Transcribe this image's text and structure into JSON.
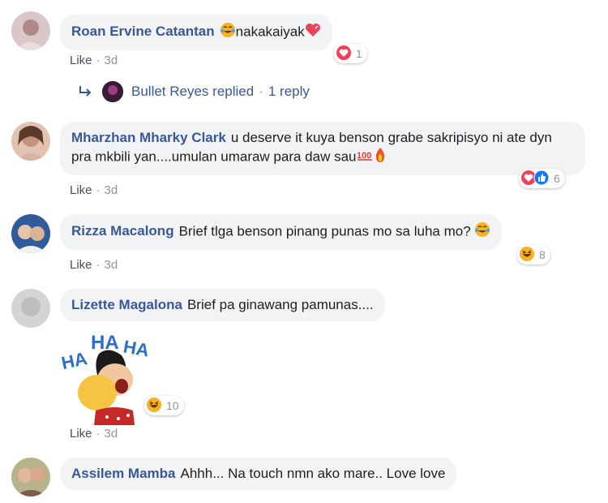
{
  "comments": [
    {
      "author": "Roan Ervine Catantan",
      "text": "nakakaiyak",
      "like": "Like",
      "time": "3d",
      "reaction_count": "1"
    },
    {
      "author": "Mharzhan Mharky Clark",
      "text": "u deserve it kuya benson grabe sakripisyo ni ate dyn pra mkbili yan....umulan umaraw para daw sau",
      "like": "Like",
      "time": "3d",
      "reaction_count": "6"
    },
    {
      "author": "Rizza Macalong",
      "text": "Brief tlga benson pinang punas mo sa luha mo?",
      "like": "Like",
      "time": "3d",
      "reaction_count": "8"
    },
    {
      "author": "Lizette Magalona",
      "text": "Brief pa ginawang pamunas....",
      "like": "Like",
      "time": "3d",
      "reaction_count": "10",
      "sticker_text": "HA HA HA"
    },
    {
      "author": "Assilem Mamba",
      "text": "Ahhh... Na touch nmn ako mare.. Love love"
    }
  ],
  "reply": {
    "name": "Bullet Reyes replied",
    "count": "1 reply"
  },
  "colors": {
    "author": "#385898",
    "bubble": "#f2f3f5",
    "meta": "#90949c",
    "love": "#f33e58",
    "like_blue": "#1877f2",
    "haha_yellow": "#f7b125"
  }
}
